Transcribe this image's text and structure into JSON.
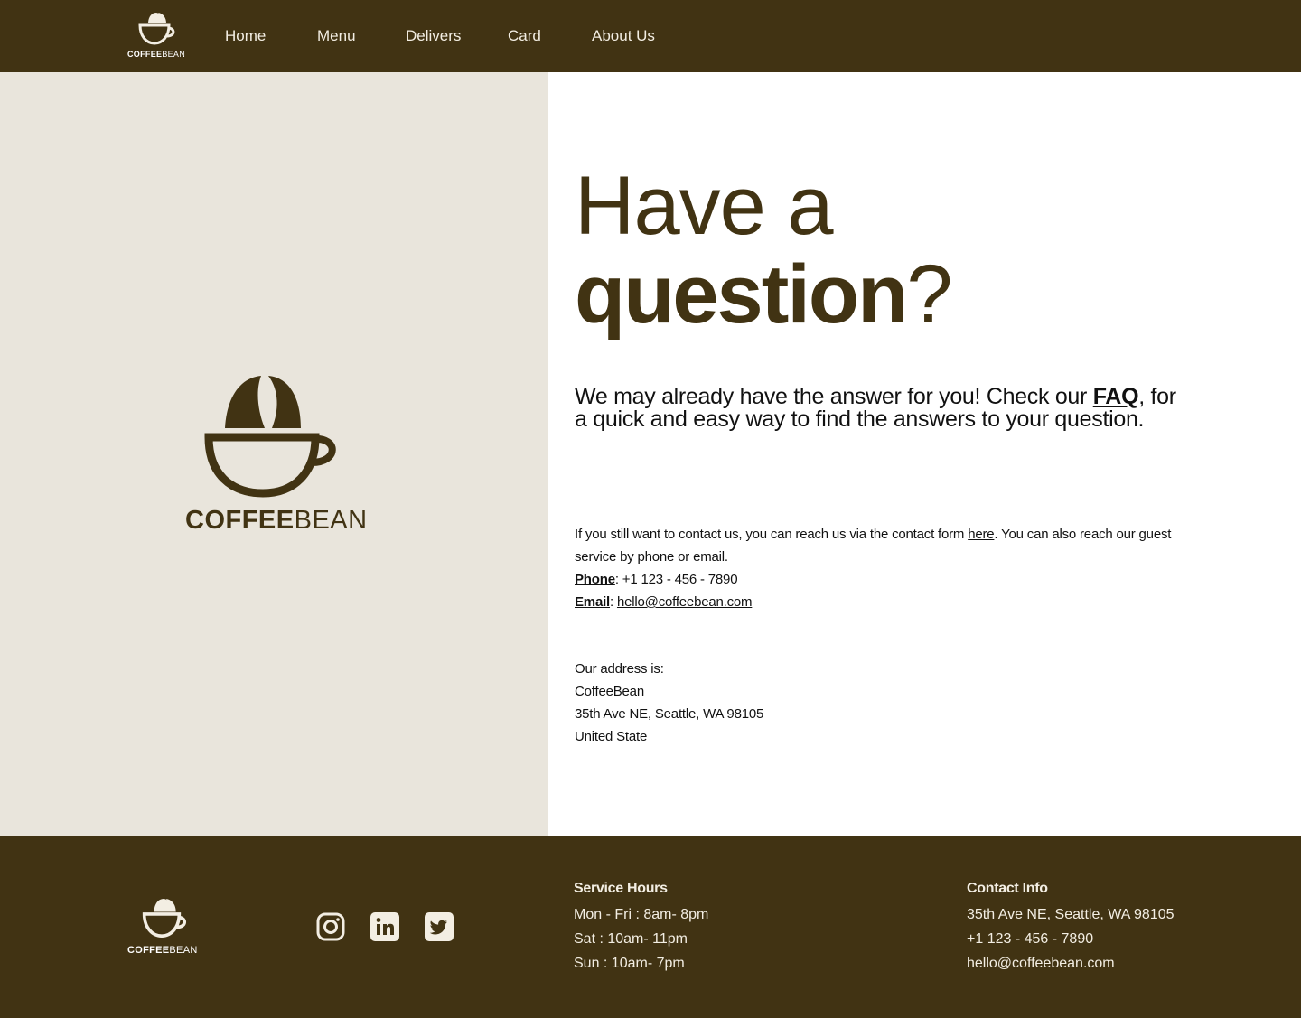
{
  "brand": {
    "name_bold": "COFFEE",
    "name_light": "BEAN"
  },
  "nav": {
    "items": [
      {
        "label": "Home"
      },
      {
        "label": "Menu"
      },
      {
        "label": "Delivers"
      },
      {
        "label": "Card"
      },
      {
        "label": "About Us"
      }
    ]
  },
  "hero": {
    "line1": "Have a",
    "line2_bold": "question",
    "line2_mark": "?",
    "intro_before": "We may already have the answer for you! Check our ",
    "intro_link": "FAQ",
    "intro_after": ", for a quick and easy way to find the answers to your question."
  },
  "contact": {
    "text_before": "If you still want to contact us, you can reach us via the contact form ",
    "form_link": "here",
    "text_after": ". You can also reach our guest service by phone or email.",
    "phone_label": "Phone",
    "phone_value": "+1  123 - 456 - 7890",
    "email_label": "Email",
    "email_value": "hello@coffeebean.com"
  },
  "address": {
    "intro": "Our address is:",
    "lines": [
      "CoffeeBean",
      "35th Ave NE, Seattle, WA 98105",
      "United State"
    ]
  },
  "footer": {
    "social": [
      "instagram-icon",
      "linkedin-icon",
      "twitter-icon"
    ],
    "service_hours": {
      "title": "Service Hours",
      "rows": [
        "Mon - Fri :  8am- 8pm",
        "Sat :  10am- 11pm",
        "Sun :  10am- 7pm"
      ]
    },
    "contact_info": {
      "title": "Contact Info",
      "rows": [
        "35th Ave NE, Seattle, WA 98105",
        "+1  123 - 456 - 7890",
        "hello@coffeebean.com"
      ]
    }
  },
  "colors": {
    "brand_brown": "#413313",
    "panel_beige": "#e9e5dc",
    "light_text": "#f3eee3"
  }
}
